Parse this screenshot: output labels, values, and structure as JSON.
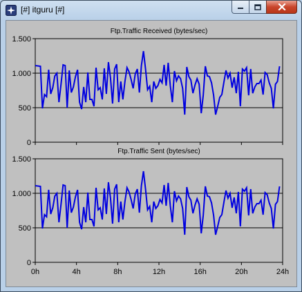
{
  "window": {
    "title": "[#] itguru [#]",
    "icon": "opnet-star-icon"
  },
  "colors": {
    "series": "#0000e0",
    "plot_bg": "#c0c0c0",
    "grid": "#000000"
  },
  "chart_data": [
    {
      "type": "line",
      "title": "Ftp.Traffic Received (bytes/sec)",
      "xlabel": "",
      "ylabel": "",
      "xlim": [
        0,
        24
      ],
      "ylim": [
        0,
        1500
      ],
      "x_unit": "hours",
      "xticks": [
        "0h",
        "4h",
        "8h",
        "12h",
        "16h",
        "20h",
        "24h"
      ],
      "yticks": [
        "0",
        "500",
        "1.000",
        "1.500"
      ],
      "grid": "horizontal",
      "series": [
        {
          "x": [
            0,
            0.5,
            0.7,
            0.9,
            1.1,
            1.3,
            1.5,
            1.7,
            1.9,
            2.1,
            2.3,
            2.5,
            2.7,
            2.9,
            3.1,
            3.3,
            3.5,
            3.7,
            3.9,
            4.1,
            4.3,
            4.5,
            4.7,
            4.9,
            5.1,
            5.3,
            5.5,
            5.7,
            5.9,
            6.1,
            6.3,
            6.5,
            6.7,
            6.9,
            7.1,
            7.3,
            7.5,
            7.7,
            7.9,
            8.1,
            8.3,
            8.5,
            8.7,
            8.9,
            9.1,
            9.3,
            9.5,
            9.7,
            9.9,
            10.1,
            10.3,
            10.5,
            10.7,
            10.9,
            11.1,
            11.3,
            11.5,
            11.7,
            11.9,
            12.1,
            12.3,
            12.5,
            12.7,
            12.9,
            13.1,
            13.3,
            13.5,
            13.7,
            13.9,
            14.1,
            14.3,
            14.5,
            14.7,
            14.9,
            15.1,
            15.3,
            15.5,
            15.7,
            15.9,
            16.1,
            16.3,
            16.5,
            16.7,
            16.9,
            17.1,
            17.3,
            17.5,
            17.7,
            17.9,
            18.1,
            18.3,
            18.5,
            18.7,
            18.9,
            19.1,
            19.3,
            19.5,
            19.7,
            19.9,
            20.1,
            20.3,
            20.5,
            20.7,
            20.9,
            21.1,
            21.3,
            21.5,
            21.7,
            21.9,
            22.1,
            22.3,
            22.5,
            22.7,
            22.9,
            23.1,
            23.3,
            23.5,
            23.7
          ],
          "values": [
            1110,
            1100,
            490,
            690,
            660,
            1050,
            700,
            790,
            960,
            1000,
            580,
            840,
            1120,
            1110,
            500,
            1040,
            720,
            800,
            950,
            1050,
            580,
            480,
            800,
            580,
            1010,
            620,
            620,
            520,
            1080,
            760,
            790,
            620,
            1070,
            700,
            1160,
            930,
            560,
            1060,
            1130,
            580,
            880,
            620,
            880,
            1080,
            1020,
            910,
            780,
            990,
            1060,
            720,
            1110,
            1320,
            1060,
            760,
            810,
            580,
            880,
            780,
            820,
            910,
            860,
            1120,
            820,
            1150,
            820,
            580,
            1030,
            890,
            960,
            920,
            780,
            400,
            1090,
            950,
            900,
            710,
            830,
            920,
            840,
            420,
            680,
            1100,
            960,
            950,
            860,
            680,
            400,
            520,
            650,
            690,
            870,
            1040,
            930,
            1000,
            790,
            940,
            710,
            1020,
            520,
            1060,
            1030,
            1080,
            680,
            1060,
            710,
            800,
            850,
            850,
            900,
            690,
            1010,
            980,
            860,
            780,
            490,
            840,
            880,
            1100
          ]
        }
      ]
    },
    {
      "type": "line",
      "title": "Ftp.Traffic Sent (bytes/sec)",
      "xlabel": "",
      "ylabel": "",
      "xlim": [
        0,
        24
      ],
      "ylim": [
        0,
        1500
      ],
      "x_unit": "hours",
      "xticks": [
        "0h",
        "4h",
        "8h",
        "12h",
        "16h",
        "20h",
        "24h"
      ],
      "yticks": [
        "0",
        "500",
        "1.000",
        "1.500"
      ],
      "grid": "horizontal",
      "series": [
        {
          "x": [
            0,
            0.5,
            0.7,
            0.9,
            1.1,
            1.3,
            1.5,
            1.7,
            1.9,
            2.1,
            2.3,
            2.5,
            2.7,
            2.9,
            3.1,
            3.3,
            3.5,
            3.7,
            3.9,
            4.1,
            4.3,
            4.5,
            4.7,
            4.9,
            5.1,
            5.3,
            5.5,
            5.7,
            5.9,
            6.1,
            6.3,
            6.5,
            6.7,
            6.9,
            7.1,
            7.3,
            7.5,
            7.7,
            7.9,
            8.1,
            8.3,
            8.5,
            8.7,
            8.9,
            9.1,
            9.3,
            9.5,
            9.7,
            9.9,
            10.1,
            10.3,
            10.5,
            10.7,
            10.9,
            11.1,
            11.3,
            11.5,
            11.7,
            11.9,
            12.1,
            12.3,
            12.5,
            12.7,
            12.9,
            13.1,
            13.3,
            13.5,
            13.7,
            13.9,
            14.1,
            14.3,
            14.5,
            14.7,
            14.9,
            15.1,
            15.3,
            15.5,
            15.7,
            15.9,
            16.1,
            16.3,
            16.5,
            16.7,
            16.9,
            17.1,
            17.3,
            17.5,
            17.7,
            17.9,
            18.1,
            18.3,
            18.5,
            18.7,
            18.9,
            19.1,
            19.3,
            19.5,
            19.7,
            19.9,
            20.1,
            20.3,
            20.5,
            20.7,
            20.9,
            21.1,
            21.3,
            21.5,
            21.7,
            21.9,
            22.1,
            22.3,
            22.5,
            22.7,
            22.9,
            23.1,
            23.3,
            23.5,
            23.7
          ],
          "values": [
            1110,
            1100,
            490,
            690,
            660,
            1050,
            700,
            790,
            960,
            1000,
            580,
            840,
            1120,
            1110,
            500,
            1040,
            720,
            800,
            950,
            1050,
            580,
            480,
            800,
            580,
            1010,
            620,
            620,
            520,
            1080,
            760,
            790,
            620,
            1070,
            700,
            1160,
            930,
            560,
            1060,
            1130,
            580,
            880,
            620,
            880,
            1080,
            1020,
            910,
            780,
            990,
            1060,
            720,
            1110,
            1320,
            1060,
            760,
            810,
            580,
            880,
            780,
            820,
            910,
            860,
            1120,
            820,
            1150,
            820,
            580,
            1030,
            890,
            960,
            920,
            780,
            400,
            1090,
            950,
            900,
            710,
            830,
            920,
            840,
            420,
            680,
            1100,
            960,
            950,
            860,
            680,
            400,
            520,
            650,
            690,
            870,
            1040,
            930,
            1000,
            790,
            940,
            710,
            1020,
            520,
            1060,
            1030,
            1080,
            680,
            1060,
            710,
            800,
            850,
            850,
            900,
            690,
            1010,
            980,
            860,
            780,
            490,
            840,
            880,
            1100
          ]
        }
      ]
    }
  ]
}
